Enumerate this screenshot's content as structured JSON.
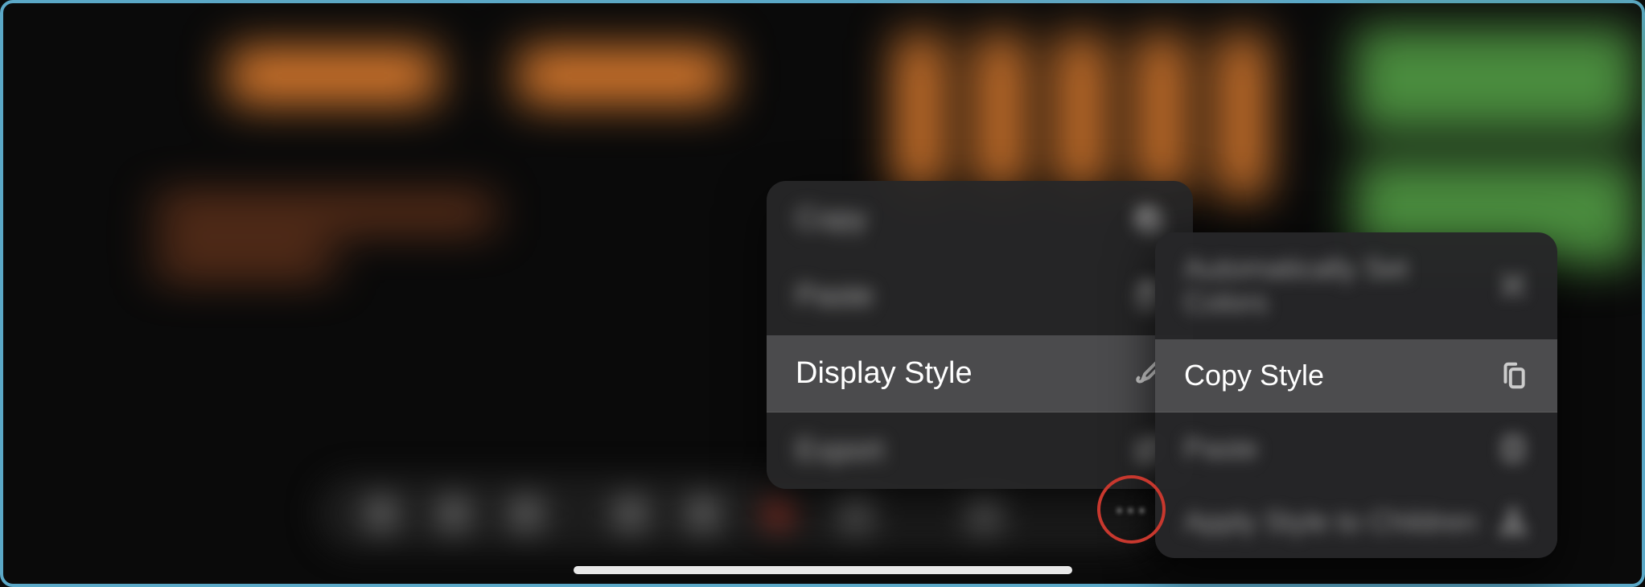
{
  "menu1": {
    "items": [
      {
        "label": "Copy"
      },
      {
        "label": "Paste"
      },
      {
        "label": "Display Style"
      },
      {
        "label": "Export"
      }
    ]
  },
  "menu2": {
    "items": [
      {
        "label": "Automatically Set Colors"
      },
      {
        "label": "Copy Style"
      },
      {
        "label": "Paste"
      },
      {
        "label": "Apply Style to Children"
      }
    ]
  },
  "toolbar": {
    "zoom_label": "100%"
  }
}
